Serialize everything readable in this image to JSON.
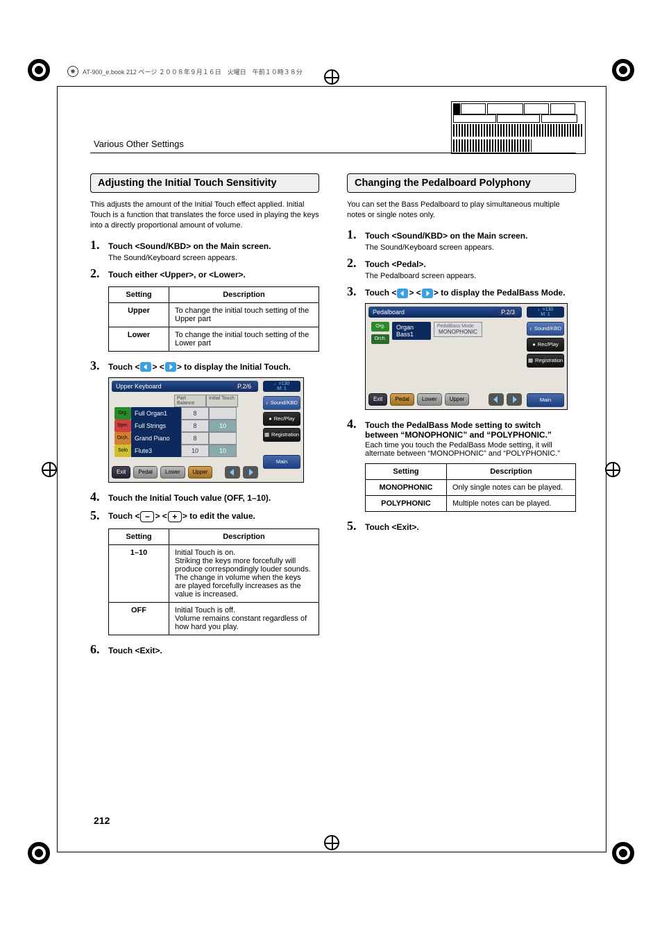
{
  "book_header": "AT-900_e.book  212 ページ  ２００８年９月１６日　火曜日　午前１０時３８分",
  "running_head": "Various Other Settings",
  "page_number": "212",
  "left": {
    "title": "Adjusting the Initial Touch Sensitivity",
    "intro": "This adjusts the amount of the Initial Touch effect applied. Initial Touch is a function that translates the force used in playing the keys into a directly proportional amount of volume.",
    "steps": {
      "s1_bold": "Touch <Sound/KBD> on the Main screen.",
      "s1_sub": "The Sound/Keyboard screen appears.",
      "s2_bold": "Touch either <Upper>, or <Lower>.",
      "s3_bold_pre": "Touch <",
      "s3_bold_mid": "> <",
      "s3_bold_post": "> to display the Initial Touch.",
      "s4_bold": "Touch the Initial Touch value (OFF, 1–10).",
      "s5_bold_pre": "Touch <",
      "s5_bold_mid": "> <",
      "s5_bold_post": "> to edit the value.",
      "s6_bold": "Touch <Exit>."
    },
    "table1": {
      "h1": "Setting",
      "h2": "Description",
      "r1s": "Upper",
      "r1d": "To change the initial touch setting of the Upper part",
      "r2s": "Lower",
      "r2d": "To change the initial touch setting of the Lower part"
    },
    "table2": {
      "h1": "Setting",
      "h2": "Description",
      "r1s": "1–10",
      "r1d": "Initial Touch is on.\nStriking the keys more forcefully will produce correspondingly louder sounds.\nThe change in volume when the keys are played forcefully increases as the value is increased.",
      "r2s": "OFF",
      "r2d": "Initial Touch is off.\nVolume remains constant regardless of how hard you play."
    },
    "screenshot": {
      "title": "Upper Keyboard",
      "page_tag": "P.2/6",
      "tempo_line1": "♩=130",
      "tempo_line2": "M:    1",
      "columns": {
        "c1": "Part Balance",
        "c2": "Initial Touch"
      },
      "rows": [
        {
          "tag": "Org.",
          "name": "Full Organ1",
          "bal": "8",
          "init": ""
        },
        {
          "tag": "Sym.",
          "name": "Full Strings",
          "bal": "8",
          "init": "10"
        },
        {
          "tag": "Orch.",
          "name": "Grand Piano",
          "bal": "8",
          "init": ""
        },
        {
          "tag": "Solo",
          "name": "Flute3",
          "bal": "10",
          "init": "10"
        }
      ],
      "side": {
        "b1": "Sound/KBD",
        "b2": "Rec/Play",
        "b3": "Registration",
        "b4": "Main"
      },
      "bottom": {
        "exit": "Exit",
        "pedal": "Pedal",
        "lower": "Lower",
        "upper": "Upper"
      }
    }
  },
  "right": {
    "title": "Changing the Pedalboard Polyphony",
    "intro": "You can set the Bass Pedalboard to play simultaneous multiple notes or single notes only.",
    "steps": {
      "s1_bold": "Touch <Sound/KBD> on the Main screen.",
      "s1_sub": "The Sound/Keyboard screen appears.",
      "s2_bold": "Touch <Pedal>.",
      "s2_sub": "The Pedalboard screen appears.",
      "s3_bold_pre": "Touch <",
      "s3_bold_mid": "> <",
      "s3_bold_post": "> to display the PedalBass Mode.",
      "s4_bold": "Touch the PedalBass Mode setting to switch between “MONOPHONIC” and “POLYPHONIC.”",
      "s4_sub": "Each time you touch the PedalBass Mode setting, it will alternate between “MONOPHONIC” and “POLYPHONIC.”",
      "s5_bold": "Touch <Exit>."
    },
    "table": {
      "h1": "Setting",
      "h2": "Description",
      "r1s": "MONOPHONIC",
      "r1d": "Only single notes can be played.",
      "r2s": "POLYPHONIC",
      "r2d": "Multiple notes can be played."
    },
    "screenshot": {
      "title": "Pedalboard",
      "page_tag": "P.2/3",
      "tempo_line1": "♩=130",
      "tempo_line2": "M:    1",
      "tag1": "Org.",
      "tag2": "Orch.",
      "voice": "Organ Bass1",
      "mode_label": "PedalBass Mode",
      "mode_value": "MONOPHONIC",
      "side": {
        "b1": "Sound/KBD",
        "b2": "Rec/Play",
        "b3": "Registration",
        "b4": "Main"
      },
      "bottom": {
        "exit": "Exit",
        "pedal": "Pedal",
        "lower": "Lower",
        "upper": "Upper"
      }
    }
  }
}
